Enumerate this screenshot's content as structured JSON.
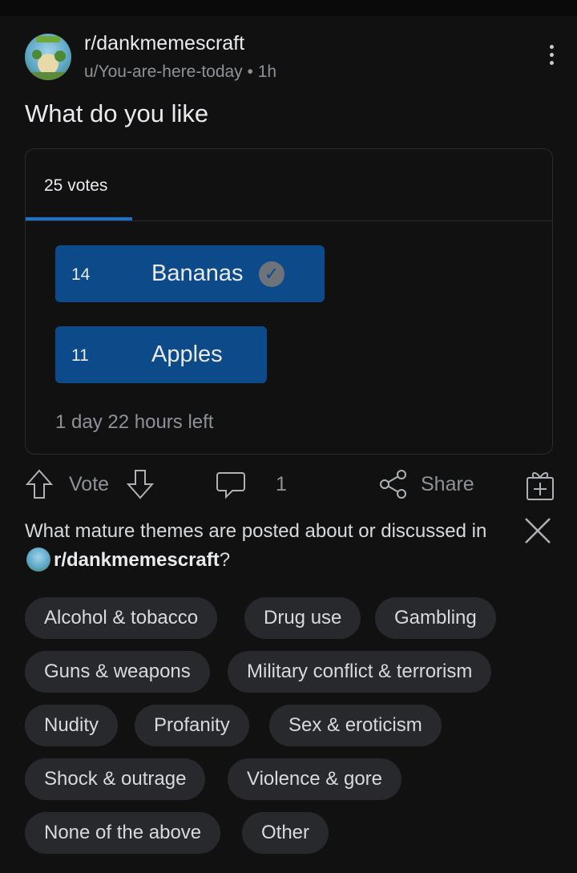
{
  "post": {
    "subreddit": "r/dankmemescraft",
    "meta": "u/You-are-here-today • 1h",
    "title": "What do you like"
  },
  "poll": {
    "votes_label": "25 votes",
    "options": [
      {
        "count": "14",
        "label": "Bananas",
        "selected": true,
        "share": 0.56
      },
      {
        "count": "11",
        "label": "Apples",
        "selected": false,
        "share": 0.44
      }
    ],
    "time_left": "1 day 22 hours left"
  },
  "actions": {
    "vote_label": "Vote",
    "comment_count": "1",
    "share_label": "Share"
  },
  "mature": {
    "question_prefix": "What mature themes are posted about or discussed in ",
    "question_subreddit": "r/dankmemescraft",
    "question_suffix": "?",
    "chips": [
      "Alcohol & tobacco",
      "Drug use",
      "Gambling",
      "Guns & weapons",
      "Military conflict & terrorism",
      "Nudity",
      "Profanity",
      "Sex & eroticism",
      "Shock & outrage",
      "Violence & gore",
      "None of the above",
      "Other"
    ]
  },
  "colors": {
    "background": "#111112",
    "poll_bar": "#0d4a8a",
    "accent": "#1a73c8",
    "chip": "#28292c"
  }
}
